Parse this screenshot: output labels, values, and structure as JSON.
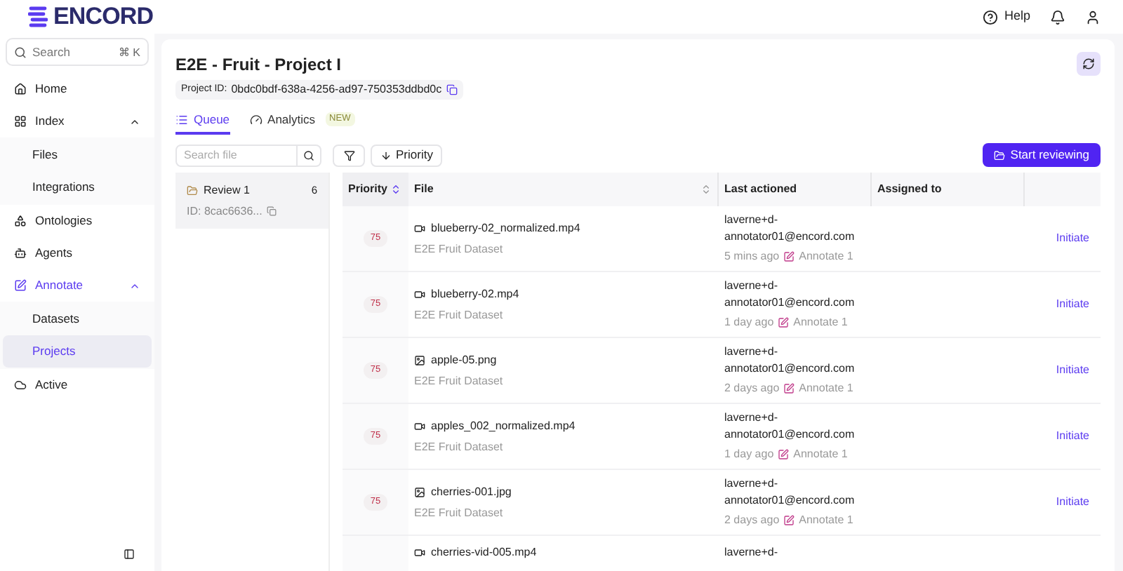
{
  "topbar": {
    "logo": "ENCORD",
    "help": "Help"
  },
  "sidebar": {
    "search": {
      "placeholder": "Search",
      "shortcut": "⌘ K"
    },
    "items": [
      {
        "label": "Home",
        "kind": "home",
        "selected": false
      },
      {
        "label": "Index",
        "kind": "index",
        "selected": false,
        "expanded": true,
        "children": [
          {
            "label": "Files",
            "selected": false
          },
          {
            "label": "Integrations",
            "selected": false
          }
        ]
      },
      {
        "label": "Ontologies",
        "kind": "ontology",
        "selected": false
      },
      {
        "label": "Agents",
        "kind": "agents",
        "selected": false
      },
      {
        "label": "Annotate",
        "kind": "annotate",
        "selected": false,
        "expanded": true,
        "children": [
          {
            "label": "Datasets",
            "selected": false
          },
          {
            "label": "Projects",
            "selected": true
          }
        ]
      },
      {
        "label": "Active",
        "kind": "active",
        "selected": false
      }
    ]
  },
  "project": {
    "title": "E2E - Fruit - Project I",
    "id_label": "Project ID:",
    "id": "0bdc0bdf-638a-4256-ad97-750353ddbd0c"
  },
  "tabs": [
    {
      "label": "Queue",
      "kind": "list",
      "selected": true
    },
    {
      "label": "Analytics",
      "kind": "gauge",
      "selected": false,
      "badge": "NEW"
    }
  ],
  "stage_search": {
    "placeholder": "Search file"
  },
  "sort_button": "Priority",
  "start_button": "Start reviewing",
  "stages": [
    {
      "name": "Review 1",
      "count": "6",
      "id": "ID: 8cac6636...",
      "selected": true
    }
  ],
  "table": {
    "columns": [
      "Priority",
      "File",
      "Last actioned",
      "Assigned to"
    ],
    "rows": [
      {
        "priority": "75",
        "kind": "video",
        "file": "blueberry-02_normalized.mp4",
        "dataset": "E2E Fruit Dataset",
        "user": "laverne+d-annotator01@encord.com",
        "time": "5 mins ago",
        "stage": "Annotate 1",
        "action": "Initiate"
      },
      {
        "priority": "75",
        "kind": "video",
        "file": "blueberry-02.mp4",
        "dataset": "E2E Fruit Dataset",
        "user": "laverne+d-annotator01@encord.com",
        "time": "1 day ago",
        "stage": "Annotate 1",
        "action": "Initiate"
      },
      {
        "priority": "75",
        "kind": "image",
        "file": "apple-05.png",
        "dataset": "E2E Fruit Dataset",
        "user": "laverne+d-annotator01@encord.com",
        "time": "2 days ago",
        "stage": "Annotate 1",
        "action": "Initiate"
      },
      {
        "priority": "75",
        "kind": "video",
        "file": "apples_002_normalized.mp4",
        "dataset": "E2E Fruit Dataset",
        "user": "laverne+d-annotator01@encord.com",
        "time": "1 day ago",
        "stage": "Annotate 1",
        "action": "Initiate"
      },
      {
        "priority": "75",
        "kind": "image",
        "file": "cherries-001.jpg",
        "dataset": "E2E Fruit Dataset",
        "user": "laverne+d-annotator01@encord.com",
        "time": "2 days ago",
        "stage": "Annotate 1",
        "action": "Initiate"
      },
      {
        "kind": "video",
        "file": "cherries-vid-005.mp4",
        "user": "laverne+d-"
      }
    ]
  }
}
